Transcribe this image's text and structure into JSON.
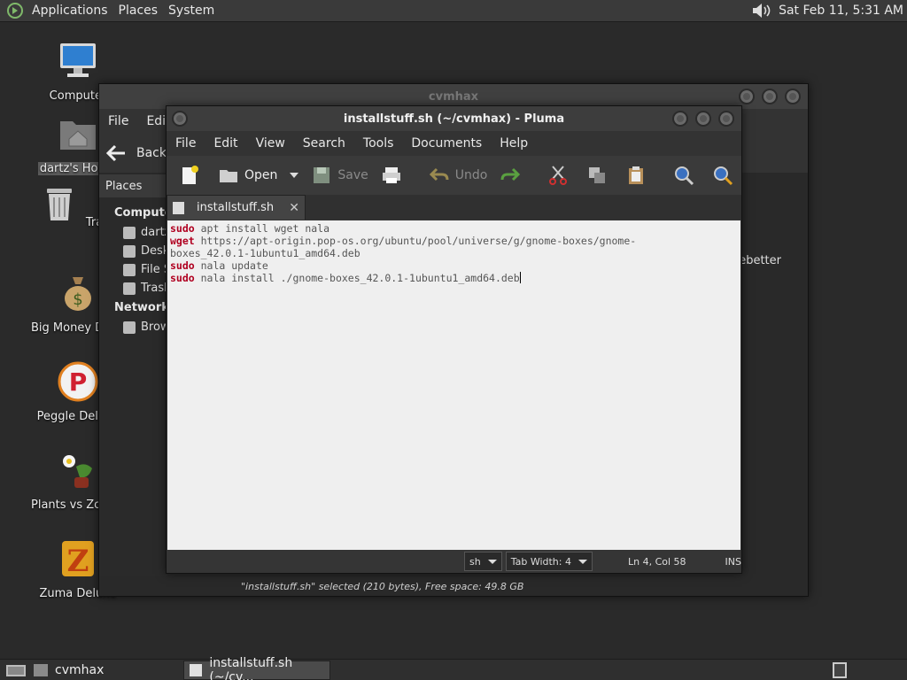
{
  "top_panel": {
    "menus": [
      "Applications",
      "Places",
      "System"
    ],
    "clock": "Sat Feb 11,  5:31 AM"
  },
  "desktop_icons": [
    {
      "label": "Computer"
    },
    {
      "label": "dartz's Home"
    },
    {
      "label": "Trash"
    },
    {
      "label": "Big Money Deluxe"
    },
    {
      "label": "Peggle Deluxe"
    },
    {
      "label": "Plants vs Zombies"
    },
    {
      "label": "Zuma Deluxe"
    }
  ],
  "caja": {
    "title": "cvmhax",
    "menu": [
      "File",
      "Edit"
    ],
    "back_label": "Back",
    "sidebar_header": "Places",
    "computer_group": "Computer",
    "items": [
      "dartz",
      "Desktop",
      "File System",
      "Trash"
    ],
    "network_group": "Network",
    "network_items": [
      "Browse Network"
    ],
    "main_file": "ebetter",
    "status": "\"installstuff.sh\" selected (210 bytes), Free space: 49.8 GB"
  },
  "pluma": {
    "title": "installstuff.sh (~/cvmhax) - Pluma",
    "menu": [
      "File",
      "Edit",
      "View",
      "Search",
      "Tools",
      "Documents",
      "Help"
    ],
    "toolbar": {
      "open": "Open",
      "save": "Save",
      "undo": "Undo"
    },
    "tab": {
      "label": "installstuff.sh",
      "close": "✕"
    },
    "lines": [
      {
        "kw": "sudo",
        "rest": " apt install wget nala"
      },
      {
        "kw": "wget",
        "rest": " https://apt-origin.pop-os.org/ubuntu/pool/universe/g/gnome-boxes/gnome-"
      },
      {
        "kw": "",
        "rest": "boxes_42.0.1-1ubuntu1_amd64.deb"
      },
      {
        "kw": "sudo",
        "rest": " nala update"
      },
      {
        "kw": "sudo",
        "rest": " nala install ./gnome-boxes_42.0.1-1ubuntu1_amd64.deb"
      }
    ],
    "status": {
      "lang": "sh",
      "tab_width": "Tab Width:  4",
      "position": "Ln 4, Col 58",
      "mode": "INS"
    }
  },
  "taskbar": [
    {
      "label": "cvmhax"
    },
    {
      "label": "installstuff.sh (~/cv..."
    }
  ],
  "colors": {
    "keyword": "#b00020",
    "editor_bg": "#efefef",
    "panel_bg": "#3a3a3a"
  }
}
